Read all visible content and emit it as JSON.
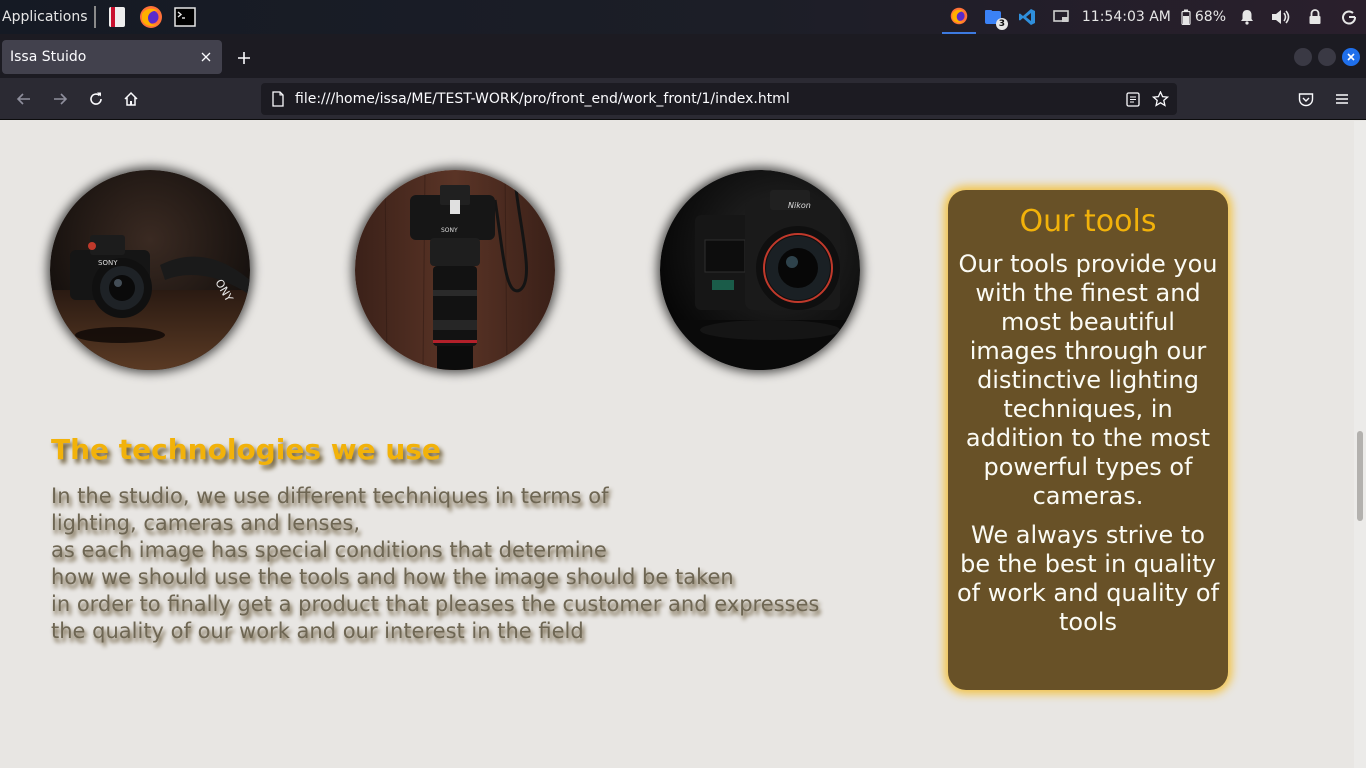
{
  "taskbar": {
    "applications_label": "Applications",
    "clock": "11:54:03 AM",
    "battery": "68%",
    "vscode_badge": "3"
  },
  "browser": {
    "tab_title": "Issa Stuido",
    "url": "file:///home/issa/ME/TEST-WORK/pro/front_end/work_front/1/index.html"
  },
  "page": {
    "tech_title": "The technologies we use",
    "tech_lines": [
      "In the studio, we use different techniques in terms of",
      "lighting, cameras and lenses,",
      "as each image has special conditions that determine",
      "how we should use the tools and how the image should be taken",
      "in order to finally get a product that pleases the customer and expresses",
      "the quality of our work and our interest in the field"
    ],
    "tools": {
      "title": "Our tools",
      "paragraph1": "Our tools provide you with the finest and most beautiful images through our distinctive lighting techniques, in addition to the most powerful types of cameras.",
      "paragraph2": "We always strive to be the best in quality of work and quality of tools"
    }
  },
  "colors": {
    "accent": "#f2b20a",
    "card_bg": "#685127",
    "card_glow": "#f2c44a",
    "page_bg": "#e8e6e3"
  },
  "icons": [
    "files-icon",
    "firefox-icon",
    "terminal-icon",
    "vscode-icon",
    "bell-icon",
    "volume-icon",
    "lock-icon",
    "power-icon",
    "reader-view-icon",
    "bookmark-star-icon",
    "pocket-icon",
    "menu-icon"
  ]
}
